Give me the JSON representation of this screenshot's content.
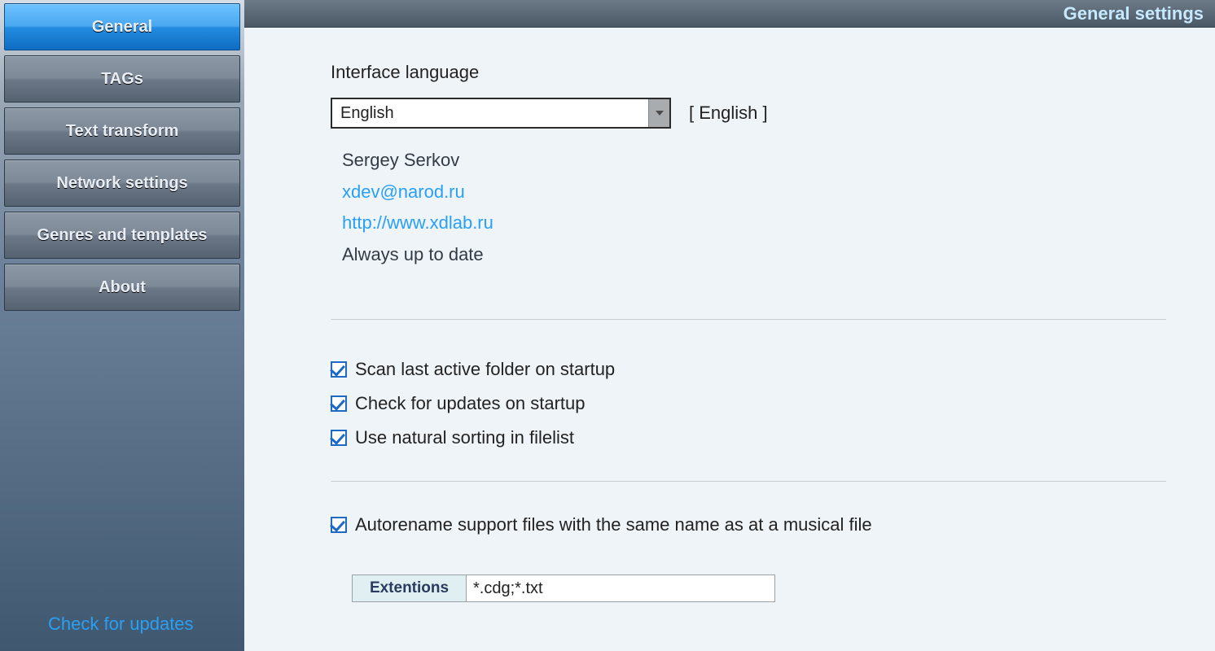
{
  "sidebar": {
    "tabs": [
      {
        "id": "general",
        "label": "General",
        "active": true
      },
      {
        "id": "tags",
        "label": "TAGs",
        "active": false
      },
      {
        "id": "transform",
        "label": "Text transform",
        "active": false
      },
      {
        "id": "network",
        "label": "Network settings",
        "active": false
      },
      {
        "id": "genres",
        "label": "Genres and templates",
        "active": false
      },
      {
        "id": "about",
        "label": "About",
        "active": false
      }
    ],
    "check_updates_link": "Check for updates"
  },
  "header": {
    "title": "General settings"
  },
  "language": {
    "label": "Interface language",
    "selected": "English",
    "bracket": "[ English ]",
    "author": {
      "name": "Sergey Serkov",
      "email": "xdev@narod.ru",
      "url": "http://www.xdlab.ru",
      "status": "Always up to date"
    }
  },
  "options": {
    "scan_startup": {
      "checked": true,
      "label": "Scan last active folder on startup"
    },
    "check_updates": {
      "checked": true,
      "label": "Check for updates on startup"
    },
    "natural_sort": {
      "checked": true,
      "label": "Use natural sorting in filelist"
    },
    "autorename": {
      "checked": true,
      "label": "Autorename support files with the same name as at a musical file"
    }
  },
  "extensions": {
    "caption": "Extentions",
    "value": "*.cdg;*.txt"
  }
}
